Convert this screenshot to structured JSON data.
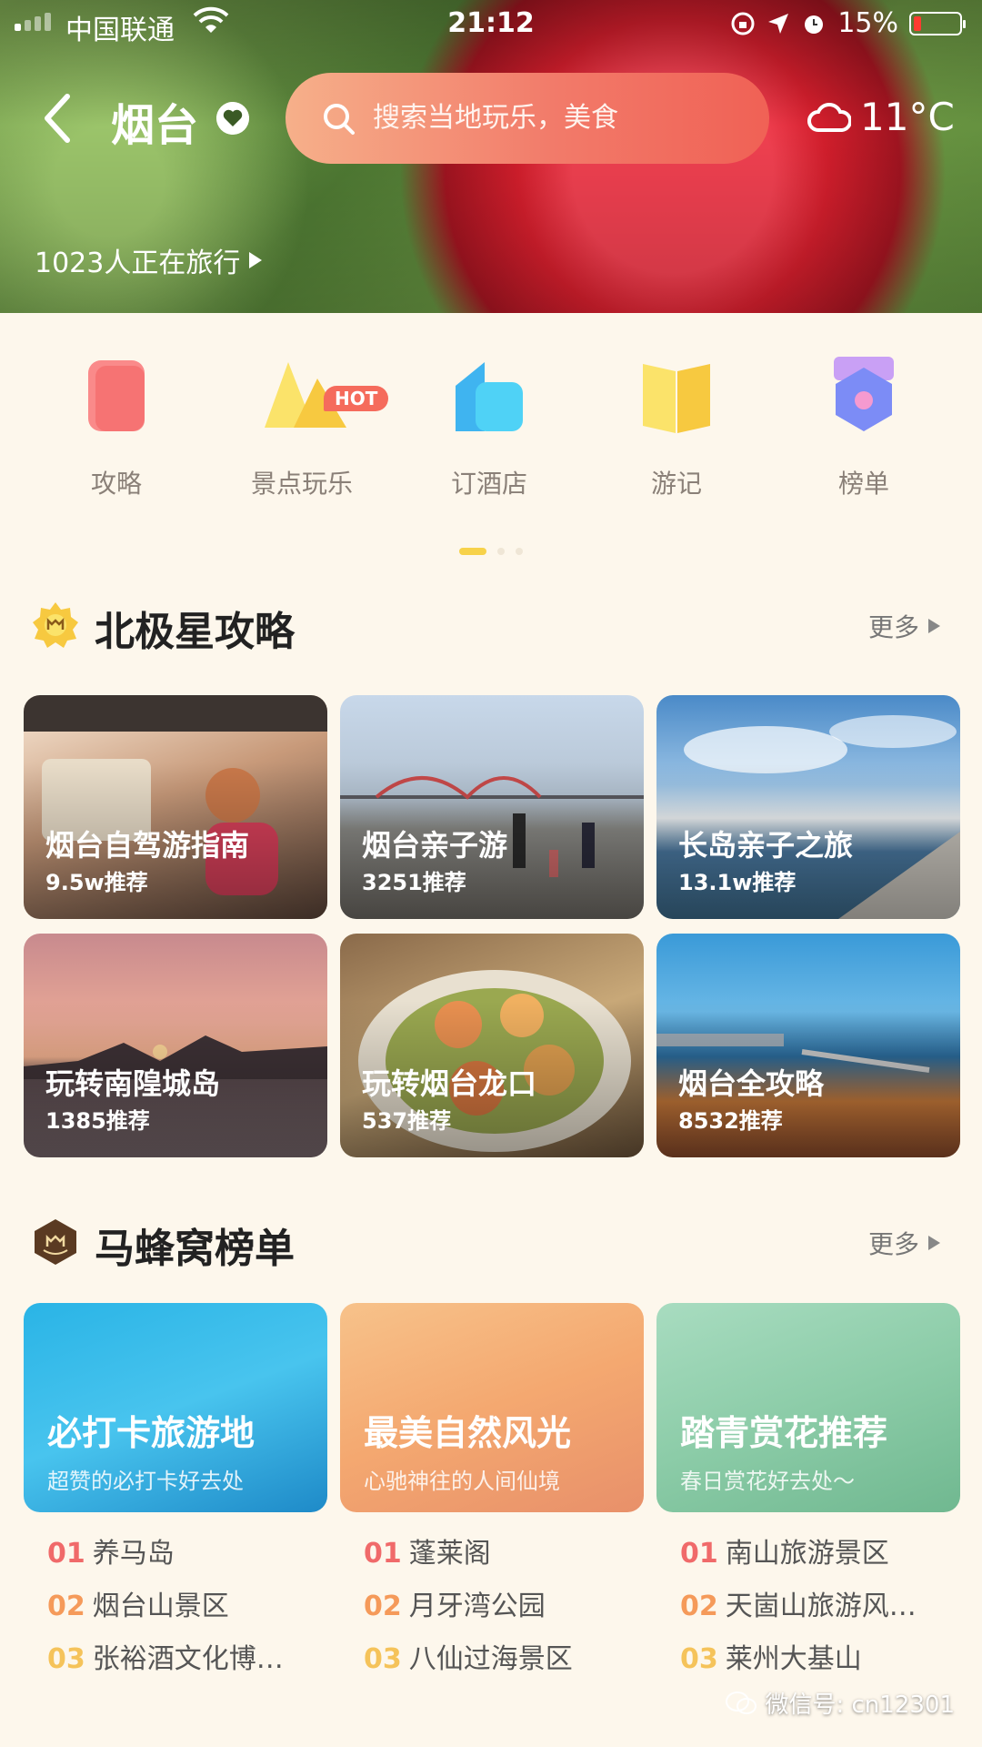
{
  "status": {
    "carrier": "中国联通",
    "time": "21:12",
    "battery": "15%"
  },
  "header": {
    "city": "烟台",
    "search_placeholder": "搜索当地玩乐，美食",
    "weather": "11°C",
    "travelers": "1023人正在旅行"
  },
  "categories": [
    {
      "label": "攻略",
      "icon": "guide-icon"
    },
    {
      "label": "景点玩乐",
      "icon": "attractions-icon",
      "badge": "HOT"
    },
    {
      "label": "订酒店",
      "icon": "hotel-icon"
    },
    {
      "label": "游记",
      "icon": "travel-notes-icon"
    },
    {
      "label": "榜单",
      "icon": "ranking-icon"
    }
  ],
  "guides": {
    "title": "北极星攻略",
    "more": "更多",
    "items": [
      {
        "title": "烟台自驾游指南",
        "sub": "9.5w推荐"
      },
      {
        "title": "烟台亲子游",
        "sub": "3251推荐"
      },
      {
        "title": "长岛亲子之旅",
        "sub": "13.1w推荐"
      },
      {
        "title": "玩转南隍城岛",
        "sub": "1385推荐"
      },
      {
        "title": "玩转烟台龙口",
        "sub": "537推荐"
      },
      {
        "title": "烟台全攻略",
        "sub": "8532推荐"
      }
    ]
  },
  "rankings": {
    "title": "马蜂窝榜单",
    "more": "更多",
    "lists": [
      {
        "title": "必打卡旅游地",
        "sub": "超赞的必打卡好去处",
        "items": [
          [
            "01",
            "养马岛"
          ],
          [
            "02",
            "烟台山景区"
          ],
          [
            "03",
            "张裕酒文化博…"
          ]
        ]
      },
      {
        "title": "最美自然风光",
        "sub": "心驰神往的人间仙境",
        "items": [
          [
            "01",
            "蓬莱阁"
          ],
          [
            "02",
            "月牙湾公园"
          ],
          [
            "03",
            "八仙过海景区"
          ]
        ]
      },
      {
        "title": "踏青赏花推荐",
        "sub": "春日赏花好去处～",
        "items": [
          [
            "01",
            "南山旅游景区"
          ],
          [
            "02",
            "天崮山旅游风…"
          ],
          [
            "03",
            "莱州大基山"
          ]
        ]
      }
    ]
  },
  "watermark": "微信号: cn12301",
  "colors": {
    "accent": "#f7d24a",
    "rank1": "#f06a6a",
    "rank2": "#f59a5a",
    "rank3": "#f5c35a"
  }
}
